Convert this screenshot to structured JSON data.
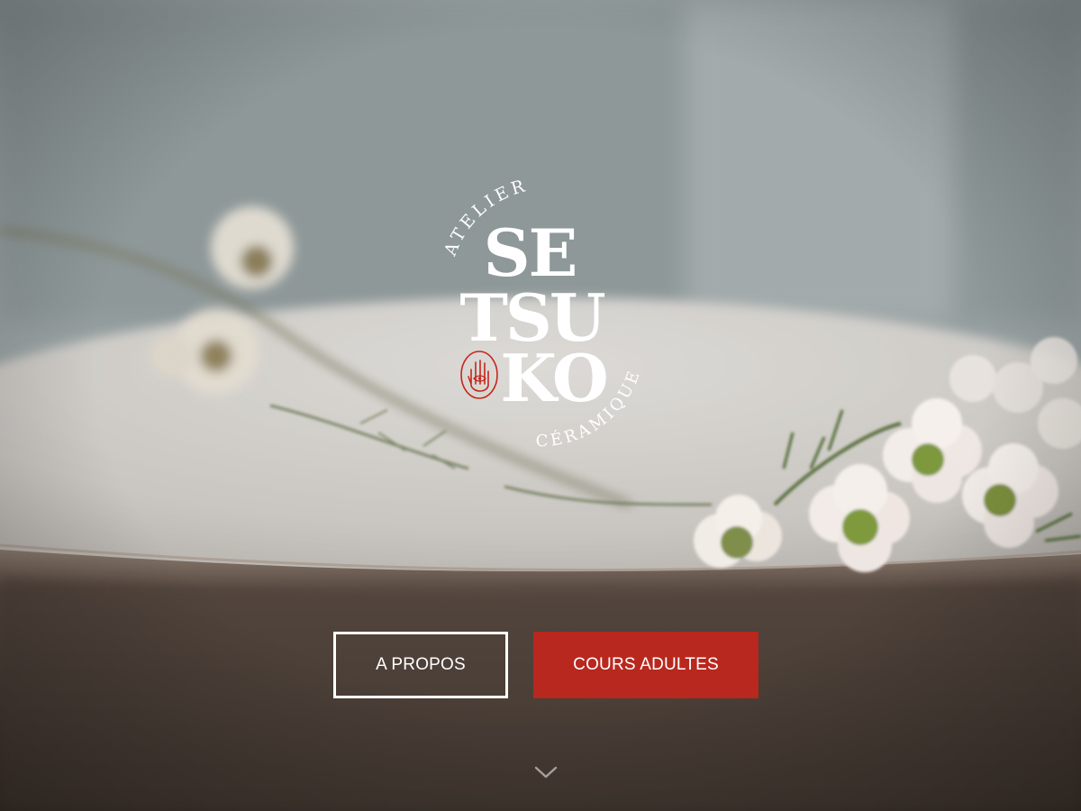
{
  "logo": {
    "arc_top": "ATELIER",
    "arc_bottom": "CÉRAMIQUE",
    "line1": "SE",
    "line2": "TSU",
    "line3": "KO",
    "emblem_icon": "hand-eye-icon"
  },
  "actions": {
    "about_label": "A PROPOS",
    "courses_label": "COURS ADULTES"
  },
  "scroll": {
    "icon": "chevron-down-icon"
  },
  "colors": {
    "accent_red": "#b8281e",
    "text_white": "#ffffff"
  }
}
